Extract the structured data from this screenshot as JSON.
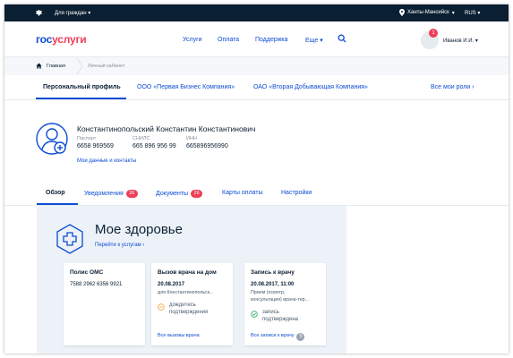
{
  "topbar": {
    "for_citizens": "Для граждан",
    "location": "Ханты-Мансийск",
    "language": "RUS"
  },
  "header": {
    "logo_part1": "гос",
    "logo_part2": "услуги",
    "nav": [
      "Услуги",
      "Оплата",
      "Поддержка",
      "Еще"
    ],
    "notification_count": "1",
    "user_name": "Иванов И.И."
  },
  "breadcrumb": [
    "Главная",
    "Личный кабинет"
  ],
  "profile_tabs": [
    "Персональный профиль",
    "ООО «Первая Бизнес Компания»",
    "ОАО «Вторая Добывающая Компания»"
  ],
  "all_roles": "Все мои роли",
  "user": {
    "full_name": "Константинопольский Константин Константинович",
    "fields": [
      {
        "label": "Паспорт",
        "value": "6658 969569"
      },
      {
        "label": "СНИЛС",
        "value": "665 896 956 99"
      },
      {
        "label": "ИНН",
        "value": "665896956990"
      }
    ],
    "my_data_link": "Мои данные и контакты"
  },
  "sub_tabs": [
    {
      "label": "Обзор",
      "count": ""
    },
    {
      "label": "Уведомления",
      "count": "26"
    },
    {
      "label": "Документы",
      "count": "26"
    },
    {
      "label": "Карты оплаты",
      "count": ""
    },
    {
      "label": "Настройки",
      "count": ""
    }
  ],
  "health": {
    "title": "Мое здоровье",
    "link": "Перейти к услугам",
    "cards": [
      {
        "title": "Полис ОМС",
        "value": "7588 2962 6356 9921"
      },
      {
        "title": "Вызов врача на дом",
        "date": "20.08.2017",
        "sub": [
          "для Константинопольск..."
        ],
        "status": [
          "дождитесь",
          "подтверждения"
        ],
        "link": "Все вызовы врача"
      },
      {
        "title": "Запись к врачу",
        "date": "20.08.2017, 11:00",
        "sub": [
          "Прием (осмотр,",
          "консультация) врача-тер..."
        ],
        "status": [
          "запись",
          "подтверждена"
        ],
        "link": "Все записи к врачу",
        "link_count": "5"
      }
    ]
  },
  "colors": {
    "primary": "#0d4cd3",
    "accent_red": "#ee3f58",
    "dark": "#0b1f33",
    "panel_bg": "#edf2f8",
    "pending": "#f5a34a",
    "confirmed": "#3cb371"
  }
}
